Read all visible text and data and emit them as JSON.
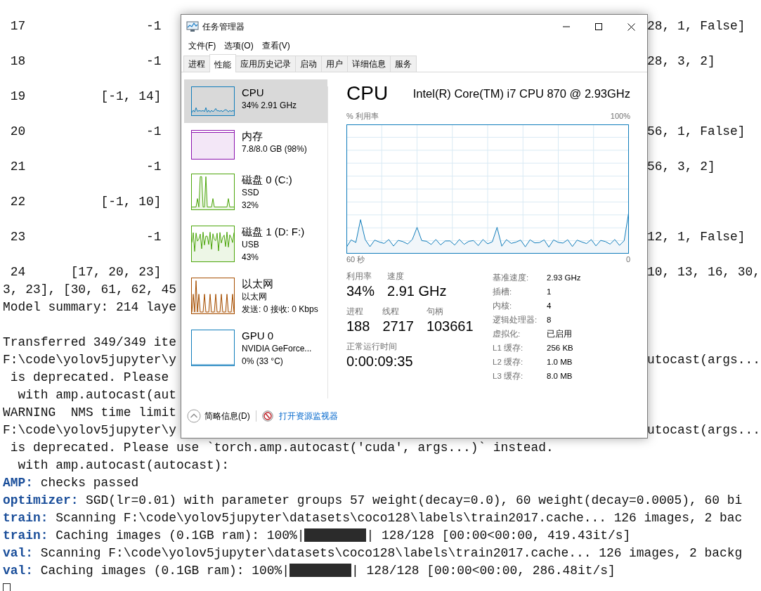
{
  "terminal": {
    "lines": [
      {
        "kind": "split",
        "left": " 17                -1",
        "right": "28, 1, False]",
        "blank_before": true
      },
      {
        "kind": "split",
        "left": " 18                -1",
        "right": "28, 3, 2]",
        "blank_before": true
      },
      {
        "kind": "split",
        "left": " 19          [-1, 14]",
        "blank_before": true
      },
      {
        "kind": "split",
        "left": " 20                -1",
        "right": "56, 1, False]",
        "blank_before": true
      },
      {
        "kind": "split",
        "left": " 21                -1",
        "right": "56, 3, 2]",
        "blank_before": true
      },
      {
        "kind": "split",
        "left": " 22          [-1, 10]",
        "blank_before": true
      },
      {
        "kind": "split",
        "left": " 23                -1",
        "right": "12, 1, False]",
        "blank_before": true
      },
      {
        "kind": "split",
        "left": " 24      [17, 20, 23]",
        "right": "10, 13, 16, 30,",
        "blank_before": true
      },
      {
        "kind": "split",
        "left": "3, 23], [30, 61, 62, 45"
      },
      {
        "kind": "split",
        "left": "Model summary: 214 laye"
      },
      {
        "kind": "split",
        "left": "Transferred 349/349 ite",
        "blank_before": true
      },
      {
        "kind": "split",
        "left": "F:\\code\\yolov5jupyter\\y",
        "right": "utocast(args..."
      },
      {
        "kind": "split",
        "left": " is deprecated. Please"
      },
      {
        "kind": "split",
        "left": "  with amp.autocast(aut"
      },
      {
        "kind": "split",
        "left": "WARNING  NMS time limit"
      },
      {
        "kind": "split",
        "left": "F:\\code\\yolov5jupyter\\y",
        "right": "utocast(args..."
      },
      {
        "kind": "full",
        "text": " is deprecated. Please use `torch.amp.autocast('cuda', args...)` instead."
      },
      {
        "kind": "full",
        "text": "  with amp.autocast(autocast):"
      },
      {
        "kind": "full",
        "text": "**AMP:** checks passed"
      },
      {
        "kind": "full",
        "text": "**optimizer:** SGD(lr=0.01) with parameter groups 57 weight(decay=0.0), 60 weight(decay=0.0005), 60 bi"
      },
      {
        "kind": "full",
        "text": "**train:** Scanning F:\\code\\yolov5jupyter\\datasets\\coco128\\labels\\train2017.cache... 126 images, 2 bac"
      },
      {
        "kind": "progress",
        "before": "**train:** Caching images (0.1GB ram): 100%|",
        "level": 1,
        "after": "| 128/128 [00:00<00:00, 419.43it/s]"
      },
      {
        "kind": "full",
        "text": "**val:** Scanning F:\\code\\yolov5jupyter\\datasets\\coco128\\labels\\train2017.cache... 126 images, 2 backg"
      },
      {
        "kind": "progress",
        "before": "**val:** Caching images (0.1GB ram): 100%|",
        "level": 1,
        "after": "| 128/128 [00:00<00:00, 286.48it/s]"
      },
      {
        "kind": "cursor"
      }
    ]
  },
  "task_manager": {
    "title": "任务管理器",
    "menu": [
      "文件(F)",
      "选项(O)",
      "查看(V)"
    ],
    "tabs": [
      {
        "label": "进程",
        "selected": false
      },
      {
        "label": "性能",
        "selected": true
      },
      {
        "label": "应用历史记录",
        "selected": false
      },
      {
        "label": "启动",
        "selected": false
      },
      {
        "label": "用户",
        "selected": false
      },
      {
        "label": "详细信息",
        "selected": false
      },
      {
        "label": "服务",
        "selected": false
      }
    ],
    "resources": [
      {
        "name": "CPU",
        "details": [
          "34% 2.91 GHz"
        ],
        "selected": true,
        "color": "#117dbb"
      },
      {
        "name": "内存",
        "details": [
          "7.8/8.0 GB (98%)"
        ],
        "selected": false,
        "color": "#8b12ae"
      },
      {
        "name": "磁盘 0 (C:)",
        "details": [
          "SSD",
          "32%"
        ],
        "selected": false,
        "color": "#4da60c"
      },
      {
        "name": "磁盘 1 (D: F:)",
        "details": [
          "USB",
          "43%"
        ],
        "selected": false,
        "color": "#4da60c"
      },
      {
        "name": "以太网",
        "details": [
          "以太网",
          "发送: 0 接收: 0 Kbps"
        ],
        "selected": false,
        "color": "#a74f01"
      },
      {
        "name": "GPU 0",
        "details": [
          "NVIDIA GeForce...",
          "0% (33 °C)"
        ],
        "selected": false,
        "color": "#117dbb"
      }
    ],
    "detail": {
      "title": "CPU",
      "model": "Intel(R) Core(TM) i7 CPU 870 @ 2.93GHz",
      "chart_label": "% 利用率",
      "chart_max": "100%",
      "chart_start": "60 秒",
      "chart_end": "0",
      "stats": [
        [
          {
            "label": "利用率",
            "value": "34%"
          },
          {
            "label": "速度",
            "value": "2.91 GHz"
          }
        ],
        [
          {
            "label": "进程",
            "value": "188"
          },
          {
            "label": "线程",
            "value": "2717"
          },
          {
            "label": "句柄",
            "value": "103661"
          }
        ],
        [
          {
            "label": "正常运行时间",
            "value": "0:00:09:35"
          }
        ]
      ],
      "properties": [
        {
          "label": "基准速度:",
          "value": "2.93 GHz"
        },
        {
          "label": "插槽:",
          "value": "1"
        },
        {
          "label": "内核:",
          "value": "4"
        },
        {
          "label": "逻辑处理器:",
          "value": "8"
        },
        {
          "label": "虚拟化:",
          "value": "已启用"
        },
        {
          "label": "L1 缓存:",
          "value": "256 KB"
        },
        {
          "label": "L2 缓存:",
          "value": "1.0 MB"
        },
        {
          "label": "L3 缓存:",
          "value": "8.0 MB"
        }
      ]
    },
    "footer": {
      "summary": "简略信息(D)",
      "monitor_link": "打开资源监视器"
    }
  }
}
